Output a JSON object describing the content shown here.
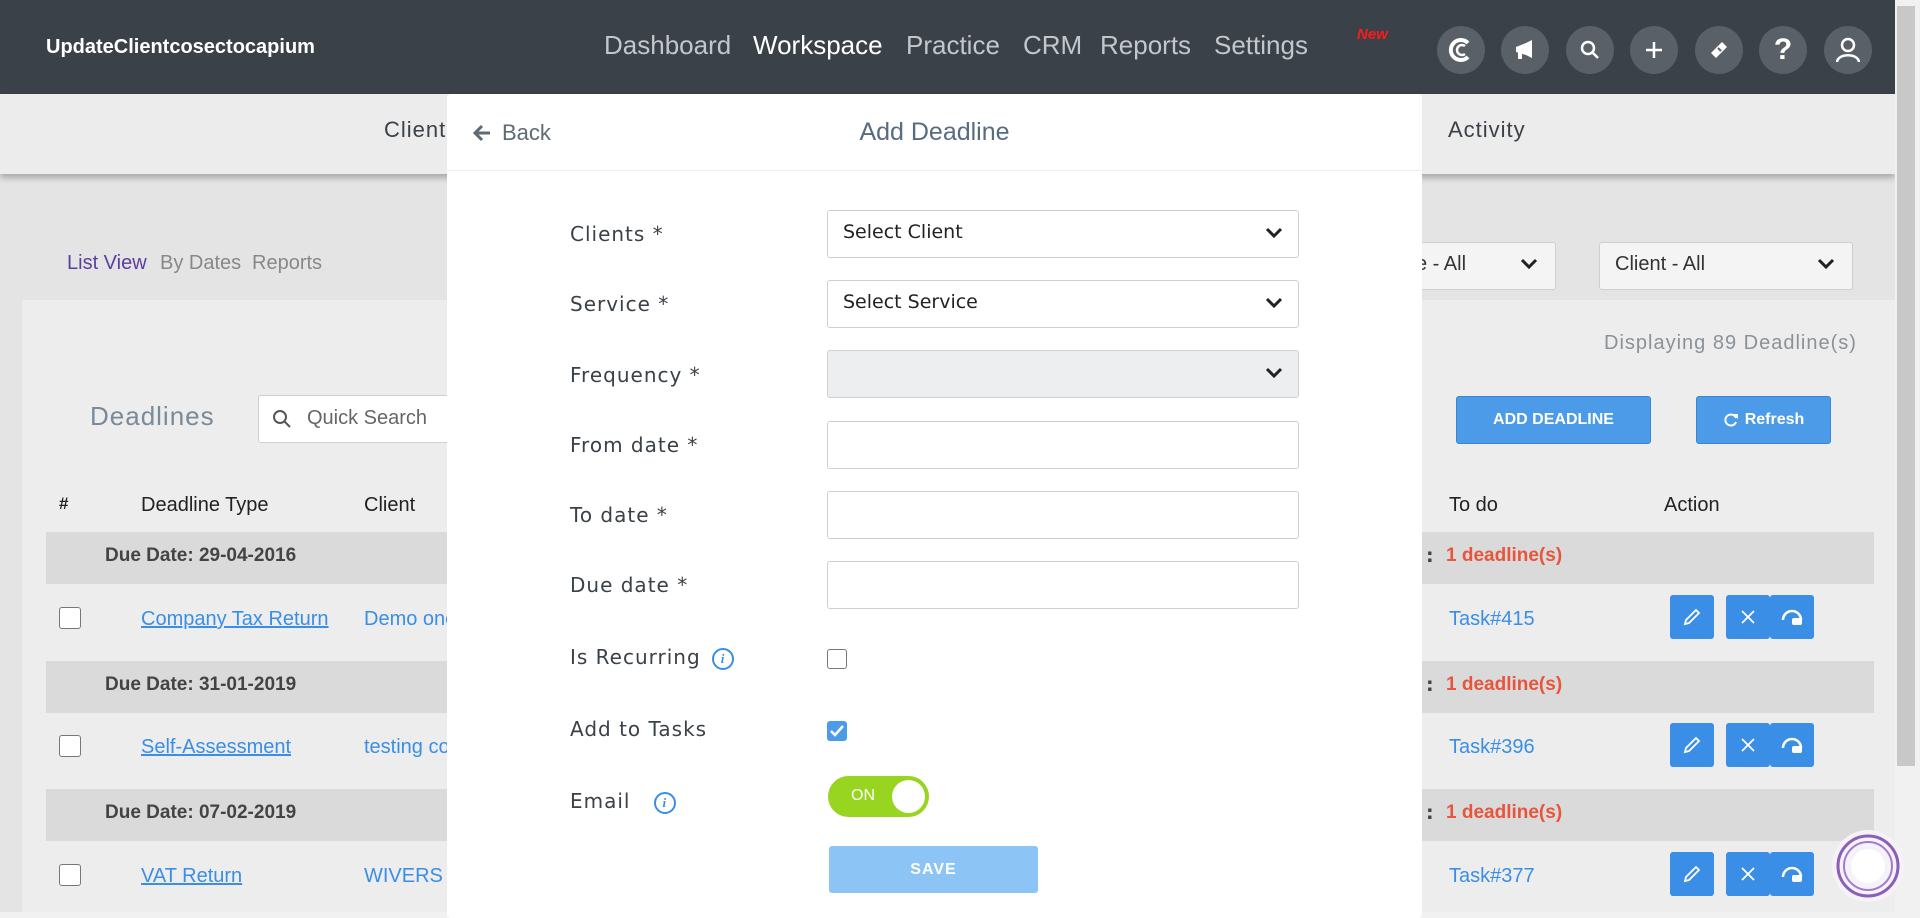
{
  "header": {
    "app_title": "UpdateClientcosectocapium",
    "nav": [
      "Dashboard",
      "Workspace",
      "Practice",
      "CRM",
      "Reports",
      "Settings"
    ],
    "new_badge": "New",
    "icons": [
      "capium-logo-icon",
      "megaphone-icon",
      "search-icon",
      "plus-icon",
      "ticket-icon",
      "help-icon",
      "user-icon"
    ]
  },
  "subnav": {
    "client_tab": "Client",
    "activity_tab": "Activity"
  },
  "views": {
    "list_view": "List View",
    "by_dates": "By Dates",
    "reports": "Reports"
  },
  "filters": {
    "service": "e - All",
    "client": "Client - All"
  },
  "summary": {
    "displaying": "Displaying 89 Deadline(s)"
  },
  "toolbar": {
    "title": "Deadlines",
    "search_placeholder": "Quick Search",
    "add_deadline": "ADD DEADLINE",
    "refresh": "Refresh"
  },
  "table": {
    "headers": {
      "num": "#",
      "type": "Deadline Type",
      "client": "Client",
      "todo": "To do",
      "action": "Action"
    },
    "groups": [
      {
        "due": "Due Date: 29-04-2016",
        "colon": ":",
        "count": "1 deadline(s)",
        "type": "Company Tax Return",
        "client": "Demo one",
        "todo": "Task#415"
      },
      {
        "due": "Due Date: 31-01-2019",
        "colon": ":",
        "count": "1 deadline(s)",
        "type": "Self-Assessment",
        "client": "testing co",
        "todo": "Task#396"
      },
      {
        "due": "Due Date: 07-02-2019",
        "colon": ":",
        "count": "1 deadline(s)",
        "type": "VAT Return",
        "client": "WIVERS E",
        "todo": "Task#377"
      }
    ]
  },
  "modal": {
    "back": "Back",
    "title": "Add Deadline",
    "fields": {
      "clients_label": "Clients *",
      "clients_value": "Select Client",
      "service_label": "Service *",
      "service_value": "Select Service",
      "frequency_label": "Frequency *",
      "frequency_value": "",
      "from_label": "From date *",
      "from_value": "",
      "to_label": "To date *",
      "to_value": "",
      "due_label": "Due date *",
      "due_value": "",
      "recurring_label": "Is Recurring",
      "recurring_checked": false,
      "tasks_label": "Add to Tasks",
      "tasks_checked": true,
      "email_label": "Email",
      "email_toggle": "ON"
    },
    "save": "SAVE"
  },
  "colors": {
    "topbar": "#3b4148",
    "accent": "#4c9be8",
    "link": "#3a8ee6",
    "alert": "#e8553d",
    "toggle_on": "#97d521"
  }
}
